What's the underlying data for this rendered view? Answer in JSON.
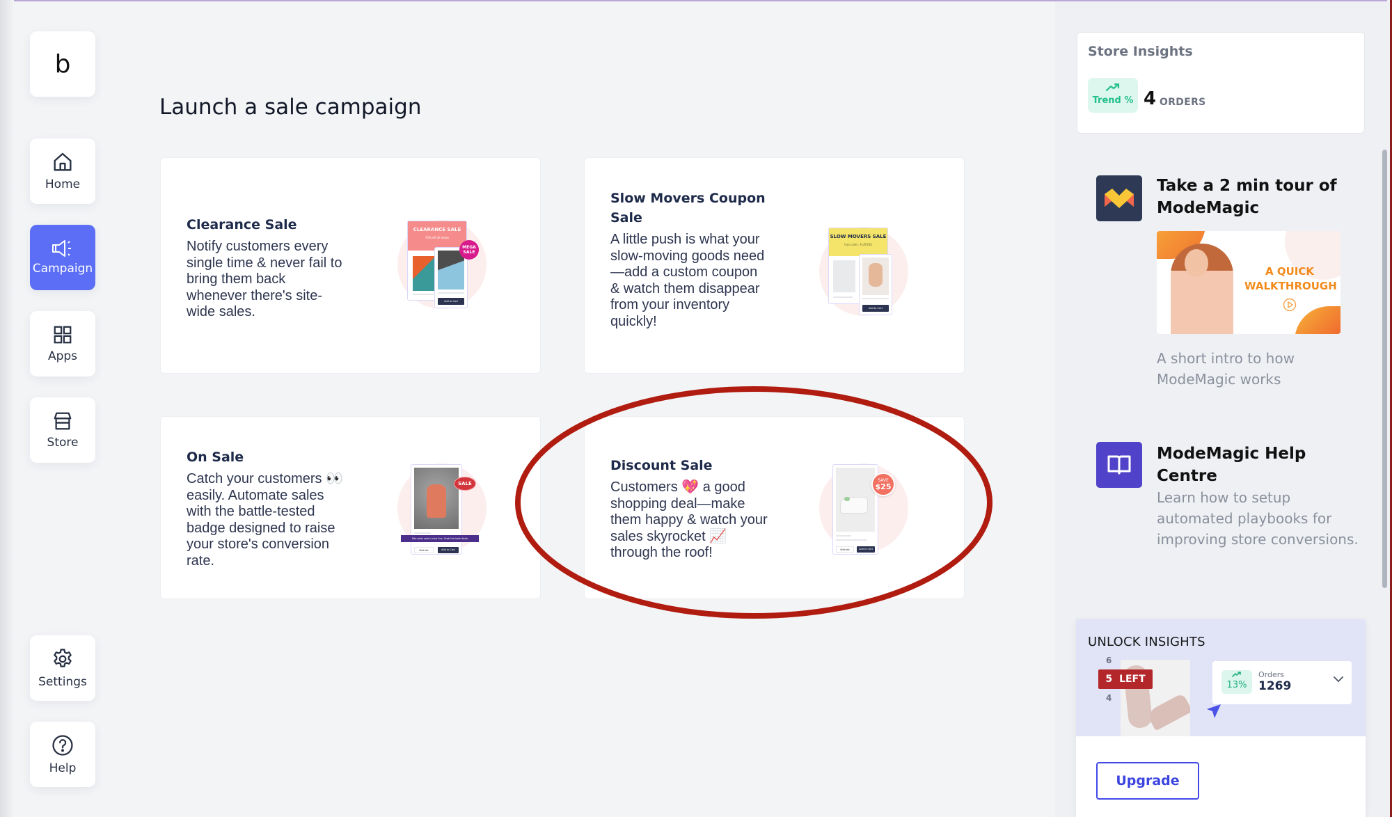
{
  "sidebar": {
    "logo": "b",
    "items": [
      {
        "id": "home",
        "label": "Home",
        "icon": "home-icon",
        "active": false
      },
      {
        "id": "campaign",
        "label": "Campaign",
        "icon": "megaphone-icon",
        "active": true
      },
      {
        "id": "apps",
        "label": "Apps",
        "icon": "grid-icon",
        "active": false
      },
      {
        "id": "store",
        "label": "Store",
        "icon": "store-icon",
        "active": false
      }
    ],
    "bottom_items": [
      {
        "id": "settings",
        "label": "Settings",
        "icon": "gear-icon"
      },
      {
        "id": "help",
        "label": "Help",
        "icon": "help-circle-icon"
      }
    ]
  },
  "main": {
    "title": "Launch a sale campaign",
    "cards": [
      {
        "title": "Clearance Sale",
        "description": "Notify customers every single time & never fail to bring them back whenever there's site-wide sales.",
        "illustration": {
          "header": "CLEARANCE SALE",
          "subheader": "70% off all shoes",
          "badge": "MEGA SALE",
          "button": "Add to Cart",
          "header_color": "#f58b8b"
        }
      },
      {
        "title": "Slow Movers Coupon Sale",
        "description": "A little push is what your slow-moving goods need—add a custom coupon & watch them disappear from your inventory quickly!",
        "illustration": {
          "header": "SLOW MOVERS SALE",
          "subheader": "Use code : FLAT200",
          "button": "Add to Cart",
          "header_color": "#f4e46a"
        }
      },
      {
        "title": "On Sale",
        "description": "Catch your customers 👀 easily. Automate sales with the battle-tested badge designed to raise your store's conversion rate.",
        "illustration": {
          "badge": "SALE",
          "banner": "Site wide sale is now live. Grab the best deals",
          "button_secondary": "Wishlist",
          "button": "Add to Cart"
        }
      },
      {
        "title": "Discount Sale",
        "description": "Customers 💖 a good shopping deal—make them happy & watch your sales skyrocket 📈 through the roof!",
        "illustration": {
          "badge_top": "SAVE",
          "badge_value": "$25",
          "button_secondary": "Wishlist",
          "button": "Add to Cart"
        },
        "highlighted": true
      }
    ],
    "annotation_color": "#b01c10"
  },
  "right_panel": {
    "store_insights": {
      "title": "Store Insights",
      "trend_label": "Trend %",
      "orders_count": "4",
      "orders_unit": "ORDERS"
    },
    "tour": {
      "title": "Take a 2 min tour of ModeMagic",
      "banner_text_1": "A QUICK",
      "banner_text_2": "WALKTHROUGH",
      "description": "A short intro to how ModeMagic works"
    },
    "help_centre": {
      "title": "ModeMagic Help Centre",
      "description": "Learn how to setup automated playbooks for improving store conversions."
    },
    "unlock": {
      "title": "UNLOCK INSIGHTS",
      "stock_above": "6",
      "stock_badge_num": "5",
      "stock_badge_label": "LEFT",
      "stock_below": "4",
      "trend_pct": "13%",
      "orders_label": "Orders",
      "orders_value": "1269",
      "upgrade_label": "Upgrade"
    }
  },
  "colors": {
    "accent": "#5b6ef5",
    "trend_green": "#22c08a",
    "help_icon_bg": "#5143c9",
    "tour_icon_bg": "#2e3a55",
    "upgrade_blue": "#3b44e0",
    "left_badge_red": "#b3262a"
  }
}
